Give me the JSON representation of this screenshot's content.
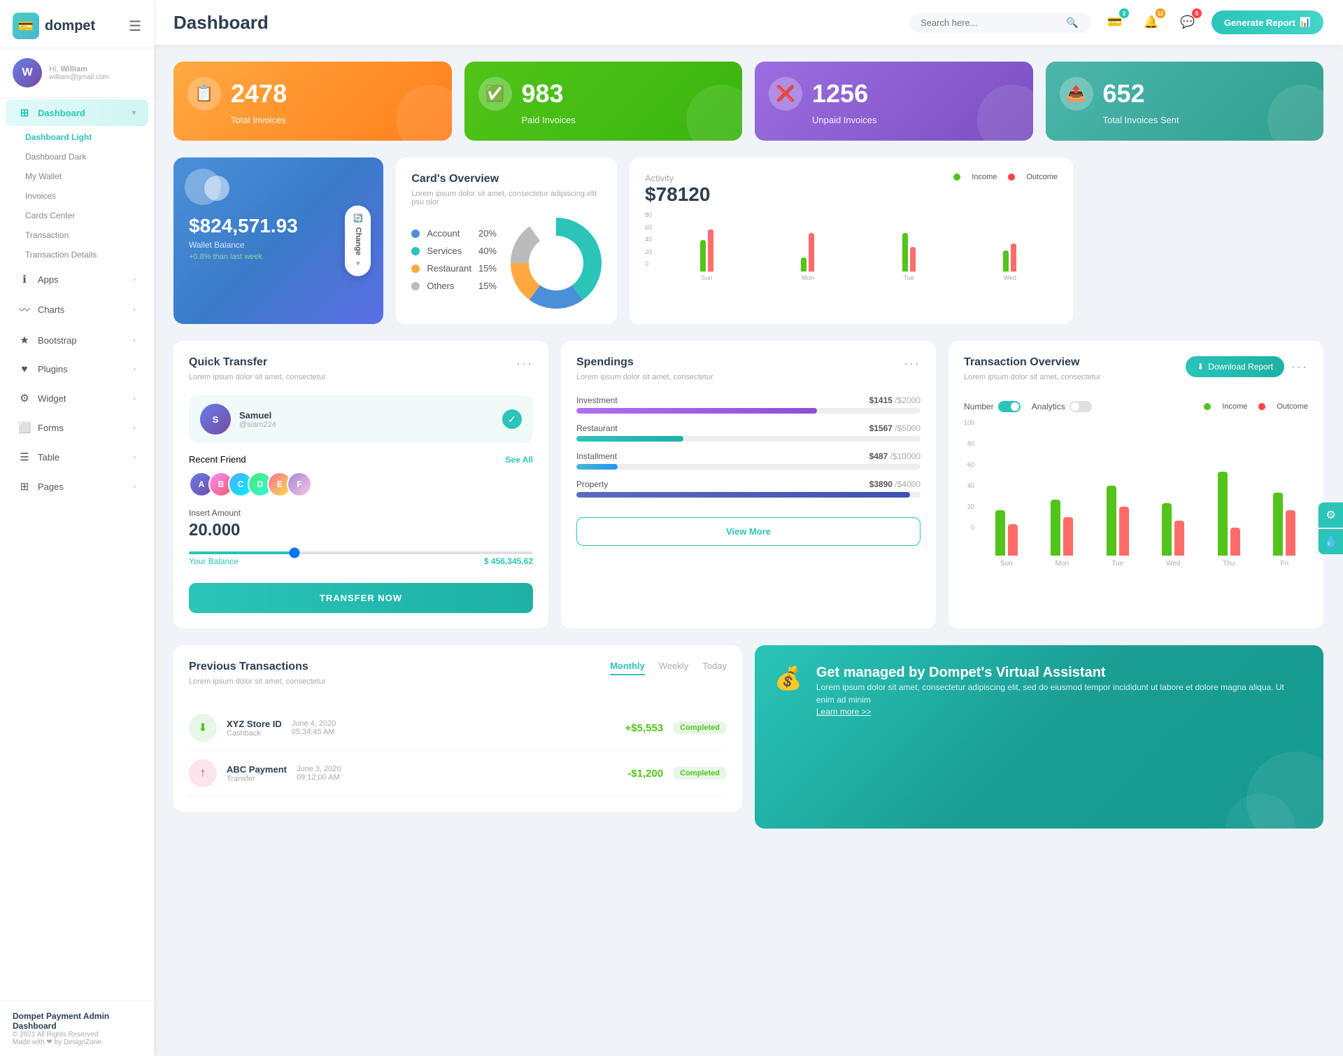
{
  "app": {
    "name": "dompet",
    "logo_icon": "💳"
  },
  "header": {
    "title": "Dashboard",
    "search_placeholder": "Search here...",
    "generate_btn": "Generate Report",
    "badges": {
      "wallet": "2",
      "bell": "12",
      "chat": "5"
    }
  },
  "sidebar": {
    "user": {
      "greeting": "Hi,",
      "name": "William",
      "email": "william@gmail.com",
      "initials": "W"
    },
    "nav_items": [
      {
        "id": "dashboard",
        "label": "Dashboard",
        "icon": "⊞",
        "active": true,
        "has_arrow": true
      },
      {
        "id": "apps",
        "label": "Apps",
        "icon": "ℹ",
        "has_arrow": true
      },
      {
        "id": "charts",
        "label": "Charts",
        "icon": "〰",
        "has_arrow": true
      },
      {
        "id": "bootstrap",
        "label": "Bootstrap",
        "icon": "★",
        "has_arrow": true
      },
      {
        "id": "plugins",
        "label": "Plugins",
        "icon": "♥",
        "has_arrow": true
      },
      {
        "id": "widget",
        "label": "Widget",
        "icon": "⚙",
        "has_arrow": true
      },
      {
        "id": "forms",
        "label": "Forms",
        "icon": "⬜",
        "has_arrow": true
      },
      {
        "id": "table",
        "label": "Table",
        "icon": "☰",
        "has_arrow": true
      },
      {
        "id": "pages",
        "label": "Pages",
        "icon": "⊞",
        "has_arrow": true
      }
    ],
    "sub_items": [
      {
        "id": "dashboard-light",
        "label": "Dashboard Light",
        "active": true
      },
      {
        "id": "dashboard-dark",
        "label": "Dashboard Dark"
      },
      {
        "id": "my-wallet",
        "label": "My Wallet"
      },
      {
        "id": "invoices",
        "label": "Invoices"
      },
      {
        "id": "cards-center",
        "label": "Cards Center"
      },
      {
        "id": "transaction",
        "label": "Transaction"
      },
      {
        "id": "transaction-details",
        "label": "Transaction Details"
      }
    ],
    "footer": {
      "title": "Dompet Payment Admin Dashboard",
      "copyright": "© 2021 All Rights Reserved",
      "made_with": "Made with ❤ by DesignZone"
    }
  },
  "stats": [
    {
      "id": "total-invoices",
      "number": "2478",
      "label": "Total Invoices",
      "icon": "📋",
      "color": "orange"
    },
    {
      "id": "paid-invoices",
      "number": "983",
      "label": "Paid Invoices",
      "icon": "✅",
      "color": "green"
    },
    {
      "id": "unpaid-invoices",
      "number": "1256",
      "label": "Unpaid Invoices",
      "icon": "❌",
      "color": "purple"
    },
    {
      "id": "sent-invoices",
      "number": "652",
      "label": "Total Invoices Sent",
      "icon": "📤",
      "color": "teal"
    }
  ],
  "wallet_card": {
    "balance": "$824,571.93",
    "label": "Wallet Balance",
    "change": "+0.8% than last week",
    "change_btn": "Change"
  },
  "cards_overview": {
    "title": "Card's Overview",
    "subtitle": "Lorem ipsum dolor sit amet, consectetur adipiscing elit psu olor",
    "items": [
      {
        "label": "Account",
        "pct": "20%",
        "color": "blue"
      },
      {
        "label": "Services",
        "pct": "40%",
        "color": "teal"
      },
      {
        "label": "Restaurant",
        "pct": "15%",
        "color": "orange"
      },
      {
        "label": "Others",
        "pct": "15%",
        "color": "gray"
      }
    ]
  },
  "activity": {
    "title": "Activity",
    "amount": "$78120",
    "legend": {
      "income": "Income",
      "outcome": "Outcome"
    },
    "bars": [
      {
        "day": "Sun",
        "income": 45,
        "outcome": 60
      },
      {
        "day": "Mon",
        "income": 20,
        "outcome": 55
      },
      {
        "day": "Tue",
        "income": 55,
        "outcome": 35
      },
      {
        "day": "Wed",
        "income": 30,
        "outcome": 40
      }
    ],
    "y_labels": [
      "80",
      "60",
      "40",
      "20",
      "0"
    ]
  },
  "quick_transfer": {
    "title": "Quick Transfer",
    "subtitle": "Lorem ipsum dolor sit amet, consectetur",
    "contact": {
      "name": "Samuel",
      "id": "@siam224",
      "initials": "S"
    },
    "recent_label": "Recent Friend",
    "see_all": "See All",
    "friends": [
      "A",
      "B",
      "C",
      "D",
      "E",
      "F"
    ],
    "amount_label": "Insert Amount",
    "amount": "20.000",
    "balance_label": "Your Balance",
    "balance": "$ 456,345.62",
    "transfer_btn": "TRANSFER NOW"
  },
  "spendings": {
    "title": "Spendings",
    "subtitle": "Lorem ipsum dolor sit amet, consectetur",
    "items": [
      {
        "label": "Investment",
        "amount": "$1415",
        "total": "/$2000",
        "pct": 70,
        "color": "fill-purple"
      },
      {
        "label": "Restaurant",
        "amount": "$1567",
        "total": "/$5000",
        "pct": 31,
        "color": "fill-teal"
      },
      {
        "label": "Installment",
        "amount": "$487",
        "total": "/$10000",
        "pct": 12,
        "color": "fill-blue"
      },
      {
        "label": "Property",
        "amount": "$3890",
        "total": "/$4000",
        "pct": 97,
        "color": "fill-indigo"
      }
    ],
    "view_more": "View More"
  },
  "transaction_overview": {
    "title": "Transaction Overview",
    "subtitle": "Lorem ipsum dolor sit amet, consectetur",
    "download_btn": "Download Report",
    "toggle_number": "Number",
    "toggle_analytics": "Analytics",
    "legend_income": "Income",
    "legend_outcome": "Outcome",
    "bars": [
      {
        "day": "Sun",
        "income": 65,
        "outcome": 45
      },
      {
        "day": "Mon",
        "income": 80,
        "outcome": 55
      },
      {
        "day": "Tue",
        "income": 100,
        "outcome": 70
      },
      {
        "day": "Wed",
        "income": 75,
        "outcome": 50
      },
      {
        "day": "Thu",
        "income": 120,
        "outcome": 40
      },
      {
        "day": "Fri",
        "income": 90,
        "outcome": 65
      }
    ],
    "y_labels": [
      "100",
      "80",
      "60",
      "40",
      "20",
      "0"
    ]
  },
  "prev_transactions": {
    "title": "Previous Transactions",
    "subtitle": "Lorem ipsum dolor sit amet, consectetur",
    "tabs": [
      "Monthly",
      "Weekly",
      "Today"
    ],
    "active_tab": "Monthly",
    "rows": [
      {
        "name": "XYZ Store ID",
        "type": "Cashback",
        "date": "June 4, 2020",
        "time": "05:34:45 AM",
        "amount": "+$5,553",
        "status": "Completed",
        "icon_color": "green"
      }
    ]
  },
  "virtual_assistant": {
    "title": "Get managed by Dompet's Virtual Assistant",
    "subtitle": "Lorem ipsum dolor sit amet, consectetur adipiscing elit, sed do eiusmod tempor incididunt ut labore et dolore magna aliqua. Ut enim ad minim",
    "link": "Learn more >>"
  },
  "right_panel": {
    "settings_icon": "⚙",
    "water_icon": "💧"
  }
}
